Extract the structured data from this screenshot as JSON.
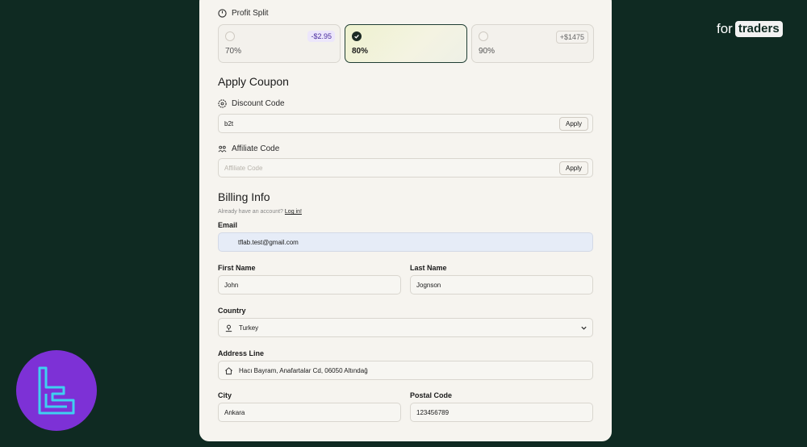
{
  "brand": {
    "for": "for",
    "traders": "traders"
  },
  "profit_split": {
    "label": "Profit Split",
    "options": [
      {
        "pct": "70%",
        "badge": "-$2.95",
        "selected": false
      },
      {
        "pct": "80%",
        "badge": "",
        "selected": true
      },
      {
        "pct": "90%",
        "badge": "+$1475",
        "selected": false
      }
    ]
  },
  "coupon": {
    "heading": "Apply Coupon",
    "discount_label": "Discount Code",
    "discount_value": "b2t",
    "affiliate_label": "Affiliate Code",
    "affiliate_placeholder": "Affiliate Code",
    "apply_label": "Apply"
  },
  "billing": {
    "heading": "Billing Info",
    "account_prompt": "Already have an account?",
    "login_link": "Log in!",
    "email_label": "Email",
    "email_value": "tflab.test@gmail.com",
    "first_name_label": "First Name",
    "first_name_value": "John",
    "last_name_label": "Last Name",
    "last_name_value": "Jognson",
    "country_label": "Country",
    "country_value": "Turkey",
    "address_label": "Address Line",
    "address_value": "Hacı Bayram, Anafartalar Cd, 06050 Altındağ",
    "city_label": "City",
    "city_value": "Ankara",
    "postal_label": "Postal Code",
    "postal_value": "123456789"
  },
  "colors": {
    "page_bg": "#0f2a22",
    "card_bg": "#f6f4ef",
    "selected_border": "#1f3d33",
    "autofill_bg": "#e6ecf7",
    "logo_bg": "#7d31d6",
    "logo_stroke": "#3fd0f0"
  }
}
